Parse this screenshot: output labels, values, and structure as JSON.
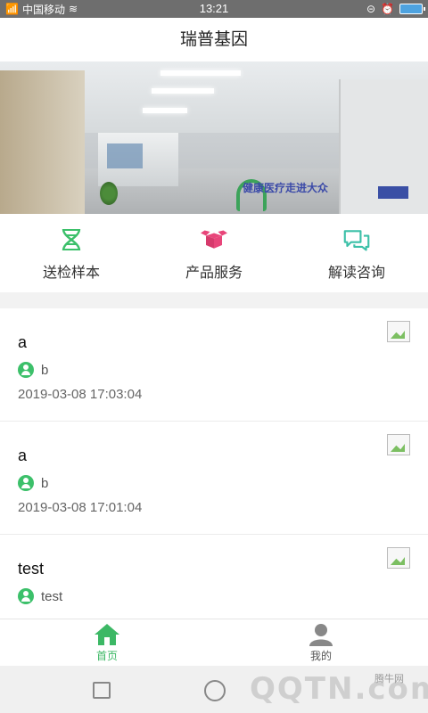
{
  "status_bar": {
    "carrier": "中国移动",
    "time": "13:21"
  },
  "app": {
    "title": "瑞普基因"
  },
  "banner": {
    "wall_text": "健康医疗走进大众",
    "active_slide": 1,
    "slide_count": 3
  },
  "quick_nav": [
    {
      "label": "送检样本",
      "icon": "dna-icon",
      "color": "#3cc06a"
    },
    {
      "label": "产品服务",
      "icon": "package-icon",
      "color": "#e8457a"
    },
    {
      "label": "解读咨询",
      "icon": "chat-icon",
      "color": "#3cc0a8"
    }
  ],
  "feed": [
    {
      "title": "a",
      "author": "b",
      "time": "2019-03-08 17:03:04"
    },
    {
      "title": "a",
      "author": "b",
      "time": "2019-03-08 17:01:04"
    },
    {
      "title": "test",
      "author": "test",
      "time": ""
    }
  ],
  "tabs": [
    {
      "label": "首页",
      "icon": "home-icon",
      "active": true
    },
    {
      "label": "我的",
      "icon": "user-icon",
      "active": false
    }
  ],
  "watermark": {
    "text": "QQTN.com",
    "small": "腾牛网"
  },
  "colors": {
    "accent": "#3cc06a"
  }
}
